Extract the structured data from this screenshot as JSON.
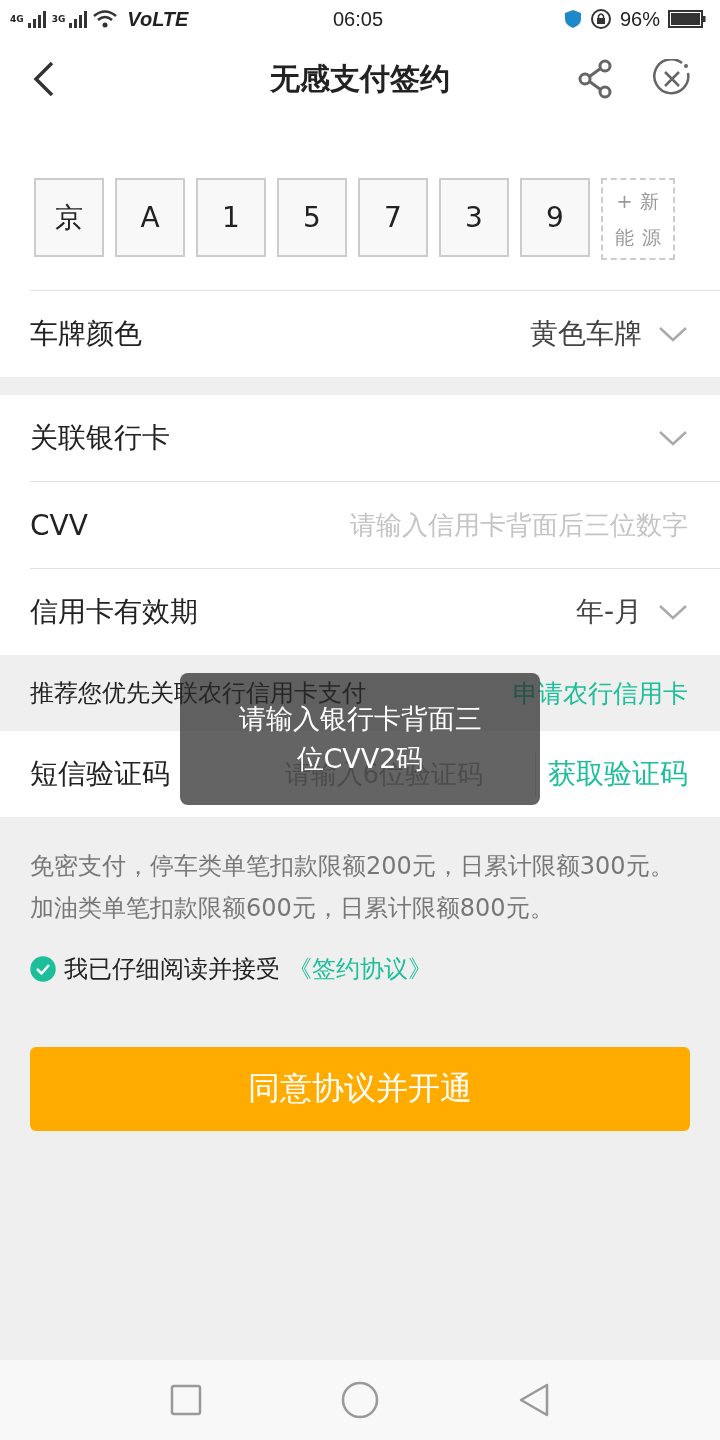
{
  "status_bar": {
    "network_1": "4G",
    "network_2": "3G",
    "volte": "VoLTE",
    "time": "06:05",
    "battery": "96%"
  },
  "header": {
    "title": "无感支付签约"
  },
  "plate": {
    "chars": [
      "京",
      "A",
      "1",
      "5",
      "7",
      "3",
      "9"
    ],
    "new_energy": "+新能源"
  },
  "plate_color": {
    "label": "车牌颜色",
    "value": "黄色车牌"
  },
  "bank_card": {
    "label": "关联银行卡"
  },
  "cvv": {
    "label": "CVV",
    "placeholder": "请输入信用卡背面后三位数字"
  },
  "expiry": {
    "label": "信用卡有效期",
    "value": "年-月"
  },
  "recommend": {
    "text": "推荐您优先关联农行信用卡支付",
    "link": "申请农行信用卡"
  },
  "sms": {
    "label": "短信验证码",
    "placeholder": "请输入6位验证码",
    "button": "获取验证码"
  },
  "note": "免密支付，停车类单笔扣款限额200元，日累计限额300元。加油类单笔扣款限额600元，日累计限额800元。",
  "agreement": {
    "checked": true,
    "text": "我已仔细阅读并接受",
    "link": "《签约协议》"
  },
  "submit": "同意协议并开通",
  "toast": "请输入银行卡背面三位CVV2码"
}
